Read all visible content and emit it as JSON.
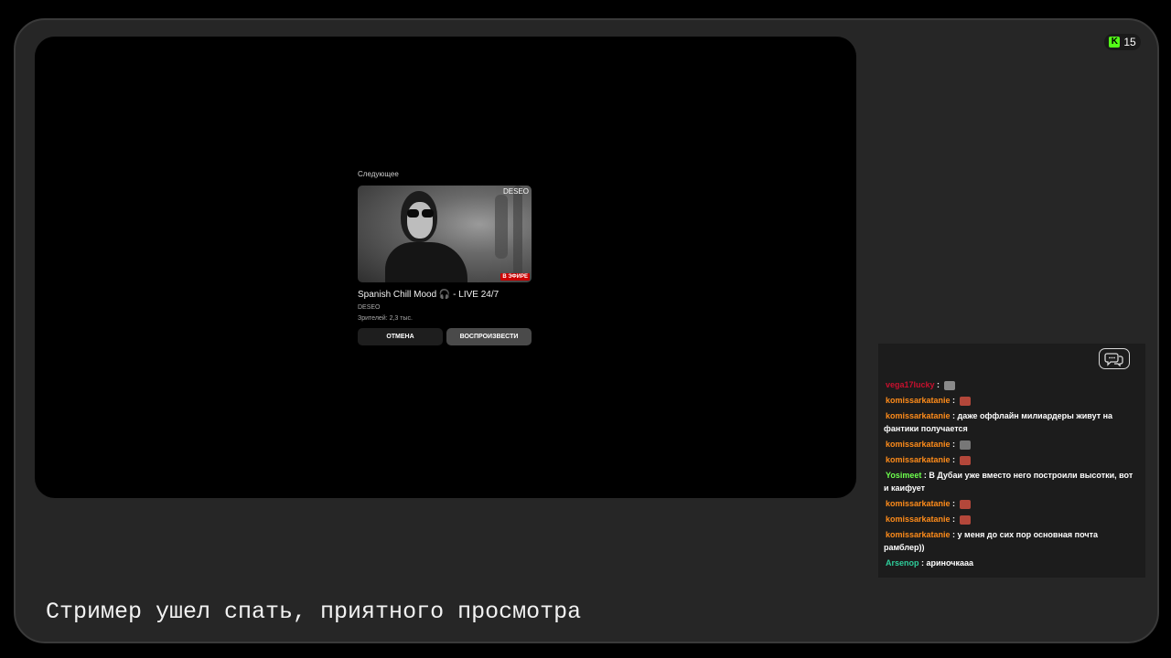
{
  "viewer": {
    "icon": "kick-logo-icon",
    "logo_letter": "K",
    "count": "15",
    "accent": "#53fc18"
  },
  "next_up": {
    "heading": "Следующее",
    "thumbnail_channel_mark": "DESEO",
    "live_badge": "В ЭФИРЕ",
    "title": "Spanish Chill Mood 🎧 - LIVE 24/7",
    "channel": "DESEO",
    "viewers": "Зрителей: 2,3 тыс.",
    "cancel_label": "ОТМЕНА",
    "play_label": "ВОСПРОИЗВЕСТИ"
  },
  "chat": {
    "icon": "chat-bubbles-icon",
    "messages": [
      {
        "user": "vega17lucky",
        "color": "#c8102e",
        "sep": " : ",
        "text": "",
        "emote": "cat-emote",
        "emote_color": "#8a8a8a"
      },
      {
        "user": "komissarkatanie",
        "color": "#ff8c1a",
        "sep": " : ",
        "text": "",
        "emote": "face-emote",
        "emote_color": "#b3473a"
      },
      {
        "user": "komissarkatanie",
        "color": "#ff8c1a",
        "sep": " : ",
        "text": "даже оффлайн милиардеры живут на фантики получается",
        "emote": "",
        "emote_color": ""
      },
      {
        "user": "komissarkatanie",
        "color": "#ff8c1a",
        "sep": " : ",
        "text": "",
        "emote": "wolf-emote",
        "emote_color": "#777777"
      },
      {
        "user": "komissarkatanie",
        "color": "#ff8c1a",
        "sep": " : ",
        "text": "",
        "emote": "face-emote",
        "emote_color": "#b3473a"
      },
      {
        "user": "Yosimeet",
        "color": "#6dff4d",
        "sep": " : ",
        "text": "В Дубаи уже вместо него построили высотки, вот и каифует",
        "emote": "",
        "emote_color": ""
      },
      {
        "user": "komissarkatanie",
        "color": "#ff8c1a",
        "sep": " : ",
        "text": "",
        "emote": "face-emote",
        "emote_color": "#b3473a"
      },
      {
        "user": "komissarkatanie",
        "color": "#ff8c1a",
        "sep": " : ",
        "text": "",
        "emote": "face-emote",
        "emote_color": "#b3473a"
      },
      {
        "user": "komissarkatanie",
        "color": "#ff8c1a",
        "sep": " : ",
        "text": "у меня до сих пор основная почта рамблер))",
        "emote": "",
        "emote_color": ""
      },
      {
        "user": "Arsenop",
        "color": "#2ecc9a",
        "sep": " : ",
        "text": "ариночкааа",
        "emote": "",
        "emote_color": ""
      }
    ]
  },
  "overlay_text": "Стример ушел спать, приятного просмотра"
}
